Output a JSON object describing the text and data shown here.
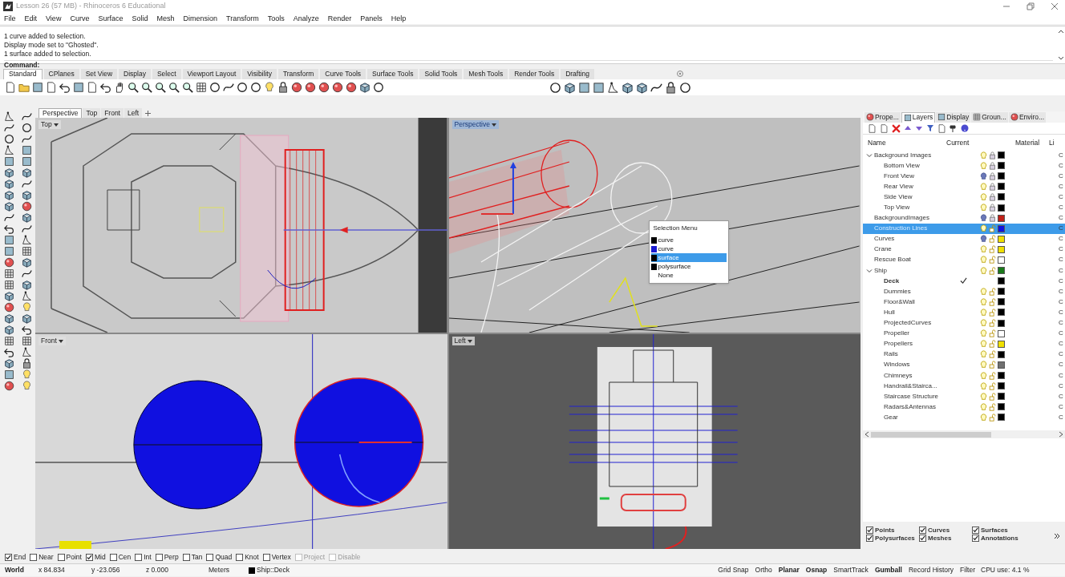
{
  "window": {
    "title": "Lesson 26 (57 MB) - Rhinoceros 6 Educational"
  },
  "menu": [
    "File",
    "Edit",
    "View",
    "Curve",
    "Surface",
    "Solid",
    "Mesh",
    "Dimension",
    "Transform",
    "Tools",
    "Analyze",
    "Render",
    "Panels",
    "Help"
  ],
  "command_history": [
    "1 curve added to selection.",
    "Display mode set to \"Ghosted\".",
    "1 surface added to selection."
  ],
  "command_prompt": "Command:",
  "toolbar_tabs": [
    {
      "label": "Standard",
      "selected": true
    },
    {
      "label": "CPlanes",
      "selected": false
    },
    {
      "label": "Set View",
      "selected": false
    },
    {
      "label": "Display",
      "selected": false
    },
    {
      "label": "Select",
      "selected": false
    },
    {
      "label": "Viewport Layout",
      "selected": false
    },
    {
      "label": "Visibility",
      "selected": false
    },
    {
      "label": "Transform",
      "selected": false
    },
    {
      "label": "Curve Tools",
      "selected": false
    },
    {
      "label": "Surface Tools",
      "selected": false
    },
    {
      "label": "Solid Tools",
      "selected": false
    },
    {
      "label": "Mesh Tools",
      "selected": false
    },
    {
      "label": "Render Tools",
      "selected": false
    },
    {
      "label": "Drafting",
      "selected": false
    }
  ],
  "viewport_tabs": [
    {
      "label": "Perspective",
      "selected": true
    },
    {
      "label": "Top",
      "selected": false
    },
    {
      "label": "Front",
      "selected": false
    },
    {
      "label": "Left",
      "selected": false
    }
  ],
  "viewports": [
    {
      "title": "Top",
      "kind": "top",
      "active": false
    },
    {
      "title": "Perspective",
      "kind": "perspective",
      "active": true
    },
    {
      "title": "Front",
      "kind": "front",
      "active": false
    },
    {
      "title": "Left",
      "kind": "left",
      "active": false
    }
  ],
  "selection_menu": {
    "title": "Selection Menu",
    "items": [
      {
        "label": "curve",
        "color": "#000000",
        "selected": false
      },
      {
        "label": "curve",
        "color": "#1a1ad0",
        "selected": false
      },
      {
        "label": "surface",
        "color": "#000000",
        "selected": true
      },
      {
        "label": "polysurface",
        "color": "#000000",
        "selected": false
      },
      {
        "label": "None",
        "selected": false
      }
    ]
  },
  "panel_tabs": [
    {
      "label": "Prope...",
      "selected": false
    },
    {
      "label": "Layers",
      "selected": true
    },
    {
      "label": "Display",
      "selected": false
    },
    {
      "label": "Groun...",
      "selected": false
    },
    {
      "label": "Enviro...",
      "selected": false
    }
  ],
  "layers": {
    "columns": [
      "Name",
      "Current",
      "Material",
      "Li"
    ],
    "rows": [
      {
        "name": "Background Images",
        "expanded": true,
        "selected": false,
        "current": false,
        "visible": true,
        "locked": true,
        "color": "#000000",
        "column_4": "C",
        "children": [
          {
            "name": "Bottom View",
            "selected": false,
            "current": false,
            "visible": true,
            "locked": true,
            "color": "#000000",
            "column_4": "C"
          },
          {
            "name": "Front View",
            "selected": false,
            "current": false,
            "visible": false,
            "locked": true,
            "color": "#000000",
            "column_4": "C"
          },
          {
            "name": "Rear View",
            "selected": false,
            "current": false,
            "visible": true,
            "locked": true,
            "color": "#000000",
            "column_4": "C"
          },
          {
            "name": "Side View",
            "selected": false,
            "current": false,
            "visible": true,
            "locked": true,
            "color": "#000000",
            "column_4": "C"
          },
          {
            "name": "Top View",
            "selected": false,
            "current": false,
            "visible": true,
            "locked": true,
            "color": "#000000",
            "column_4": "C"
          }
        ]
      },
      {
        "name": "BackgroundImages",
        "selected": false,
        "current": false,
        "visible": false,
        "locked": true,
        "color": "#c02018",
        "column_4": "C"
      },
      {
        "name": "Construction Lines",
        "selected": true,
        "current": false,
        "visible": true,
        "locked": false,
        "color": "#1010e0",
        "column_4": "C"
      },
      {
        "name": "Curves",
        "selected": false,
        "current": false,
        "visible": false,
        "locked": false,
        "color": "#f0e000",
        "column_4": "C"
      },
      {
        "name": "Crane",
        "selected": false,
        "current": false,
        "visible": true,
        "locked": false,
        "color": "#f0e000",
        "column_4": "C"
      },
      {
        "name": "Rescue Boat",
        "selected": false,
        "current": false,
        "visible": true,
        "locked": false,
        "color": "#ffffff",
        "column_4": "C"
      },
      {
        "name": "Ship",
        "expanded": true,
        "selected": false,
        "current": false,
        "visible": true,
        "locked": false,
        "color": "#1a7a1a",
        "column_4": "C",
        "children": [
          {
            "name": "Deck",
            "selected": false,
            "current": true,
            "color": "#000000",
            "column_4": "C"
          },
          {
            "name": "Dummies",
            "selected": false,
            "current": false,
            "visible": true,
            "locked": false,
            "color": "#000000",
            "column_4": "C"
          },
          {
            "name": "Floor&Wall",
            "selected": false,
            "current": false,
            "visible": true,
            "locked": false,
            "color": "#000000",
            "column_4": "C"
          },
          {
            "name": "Hull",
            "selected": false,
            "current": false,
            "visible": true,
            "locked": false,
            "color": "#000000",
            "column_4": "C"
          },
          {
            "name": "ProjectedCurves",
            "selected": false,
            "current": false,
            "visible": true,
            "locked": false,
            "color": "#000000",
            "column_4": "C"
          },
          {
            "name": "Propeller",
            "selected": false,
            "current": false,
            "visible": true,
            "locked": false,
            "color": "#ffffff",
            "column_4": "C"
          },
          {
            "name": "Propellers",
            "selected": false,
            "current": false,
            "visible": true,
            "locked": false,
            "color": "#f0e000",
            "column_4": "C"
          },
          {
            "name": "Rails",
            "selected": false,
            "current": false,
            "visible": true,
            "locked": false,
            "color": "#000000",
            "column_4": "C"
          },
          {
            "name": "Windows",
            "selected": false,
            "current": false,
            "visible": true,
            "locked": false,
            "color": "#707070",
            "column_4": "C"
          },
          {
            "name": "Chimneys",
            "selected": false,
            "current": false,
            "visible": true,
            "locked": false,
            "color": "#000000",
            "column_4": "C"
          },
          {
            "name": "Handrail&Stairca...",
            "selected": false,
            "current": false,
            "visible": true,
            "locked": false,
            "color": "#000000",
            "column_4": "C"
          },
          {
            "name": "Staircase Structure",
            "selected": false,
            "current": false,
            "visible": true,
            "locked": false,
            "color": "#000000",
            "column_4": "C"
          },
          {
            "name": "Radars&Antennas",
            "selected": false,
            "current": false,
            "visible": true,
            "locked": false,
            "color": "#000000",
            "column_4": "C"
          },
          {
            "name": "Gear",
            "selected": false,
            "current": false,
            "visible": true,
            "locked": false,
            "color": "#000000",
            "column_4": "C"
          }
        ]
      }
    ]
  },
  "object_filters": [
    {
      "label": "Points",
      "checked": true
    },
    {
      "label": "Curves",
      "checked": true
    },
    {
      "label": "Surfaces",
      "checked": true
    },
    {
      "label": "Polysurfaces",
      "checked": true
    },
    {
      "label": "Meshes",
      "checked": true
    },
    {
      "label": "Annotations",
      "checked": true
    }
  ],
  "osnaps": [
    {
      "label": "End",
      "checked": true,
      "disabled": false
    },
    {
      "label": "Near",
      "checked": false,
      "disabled": false
    },
    {
      "label": "Point",
      "checked": false,
      "disabled": false
    },
    {
      "label": "Mid",
      "checked": true,
      "disabled": false
    },
    {
      "label": "Cen",
      "checked": false,
      "disabled": false
    },
    {
      "label": "Int",
      "checked": false,
      "disabled": false
    },
    {
      "label": "Perp",
      "checked": false,
      "disabled": false
    },
    {
      "label": "Tan",
      "checked": false,
      "disabled": false
    },
    {
      "label": "Quad",
      "checked": false,
      "disabled": false
    },
    {
      "label": "Knot",
      "checked": false,
      "disabled": false
    },
    {
      "label": "Vertex",
      "checked": false,
      "disabled": false
    },
    {
      "label": "Project",
      "checked": false,
      "disabled": true
    },
    {
      "label": "Disable",
      "checked": false,
      "disabled": true
    }
  ],
  "status_bar": {
    "cplane": "World",
    "x": "x 84.834",
    "y": "y -23.056",
    "z": "z 0.000",
    "units": "Meters",
    "layer": "Ship::Deck",
    "toggles": [
      {
        "label": "Grid Snap",
        "on": false
      },
      {
        "label": "Ortho",
        "on": false
      },
      {
        "label": "Planar",
        "on": true
      },
      {
        "label": "Osnap",
        "on": true
      },
      {
        "label": "SmartTrack",
        "on": false
      },
      {
        "label": "Gumball",
        "on": true
      },
      {
        "label": "Record History",
        "on": false
      },
      {
        "label": "Filter",
        "on": false
      }
    ],
    "cpu": "CPU use: 4.1 %"
  }
}
